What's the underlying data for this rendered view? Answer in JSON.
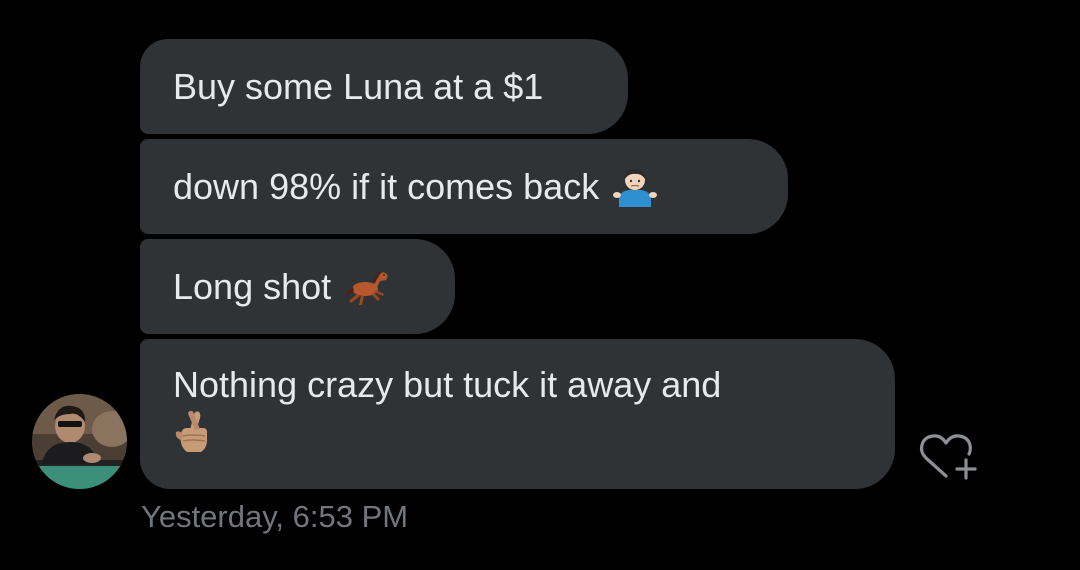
{
  "messages": [
    {
      "text": "Buy some Luna at a $1",
      "emoji": ""
    },
    {
      "text": "down 98%  if it comes back",
      "emoji": "person-shrugging-emoji"
    },
    {
      "text": "Long shot",
      "emoji": "horse-emoji"
    },
    {
      "text": "Nothing crazy but tuck it away and",
      "emoji": "crossed-fingers-emoji"
    }
  ],
  "timestamp": "Yesterday, 6:53 PM",
  "reaction": {
    "icon": "add-reaction-heart-icon"
  },
  "colors": {
    "background": "#000000",
    "bubble": "#2f3336",
    "text": "#e7e9ea",
    "timestamp": "#71767b",
    "icon": "#8b9095"
  }
}
